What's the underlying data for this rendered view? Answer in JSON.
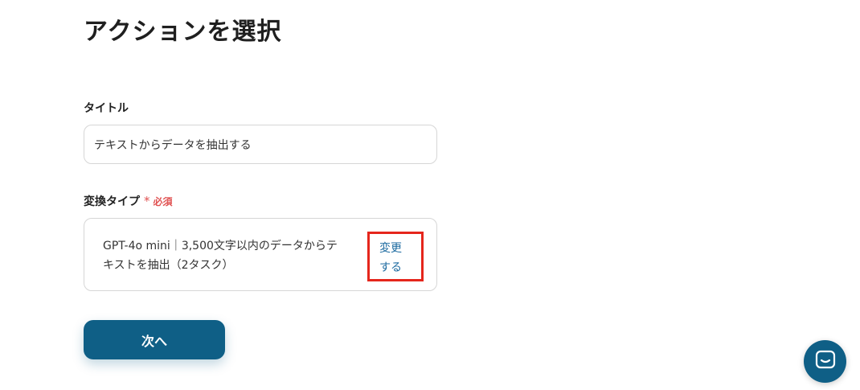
{
  "page": {
    "title": "アクションを選択"
  },
  "form": {
    "title_field": {
      "label": "タイトル",
      "value": "テキストからデータを抽出する"
    },
    "type_field": {
      "label": "変換タイプ",
      "required_mark": "*",
      "required_text": "必須",
      "value_line1": "GPT-4o mini｜3,500文字以内のデータからテ",
      "value_line2": "キストを抽出（2タスク）",
      "change_line1": "変更",
      "change_line2": "する"
    },
    "next_button": "次へ"
  },
  "chat": {
    "icon": "chat-bubble-icon"
  },
  "colors": {
    "primary": "#0f5f86",
    "required": "#e05252",
    "link": "#1c6aa0",
    "highlight_border": "#e5261c"
  }
}
